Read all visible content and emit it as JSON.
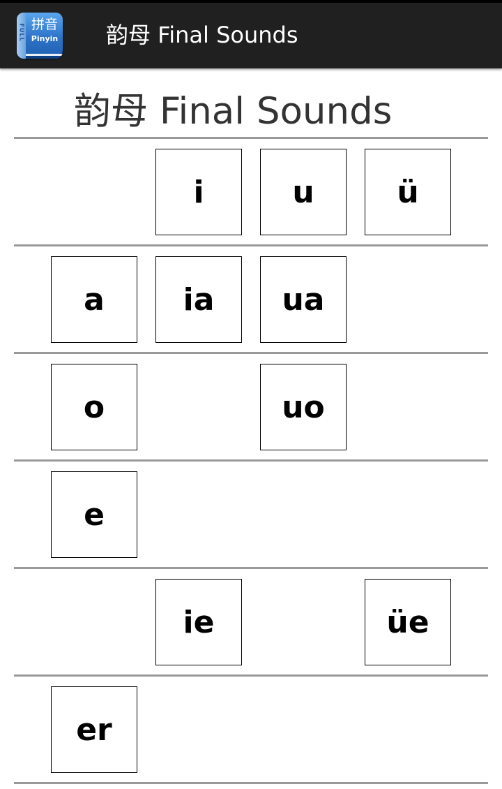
{
  "app": {
    "icon_hanzi": "拼音",
    "icon_label": "Pinyin",
    "icon_spine": "FULL",
    "title": "韵母 Final Sounds"
  },
  "page": {
    "heading": "韵母 Final Sounds"
  },
  "rows": [
    [
      "",
      "i",
      "u",
      "ü"
    ],
    [
      "a",
      "ia",
      "ua",
      ""
    ],
    [
      "o",
      "",
      "uo",
      ""
    ],
    [
      "e",
      "",
      "",
      ""
    ],
    [
      "",
      "ie",
      "",
      "üe"
    ],
    [
      "er",
      "",
      "",
      ""
    ]
  ]
}
